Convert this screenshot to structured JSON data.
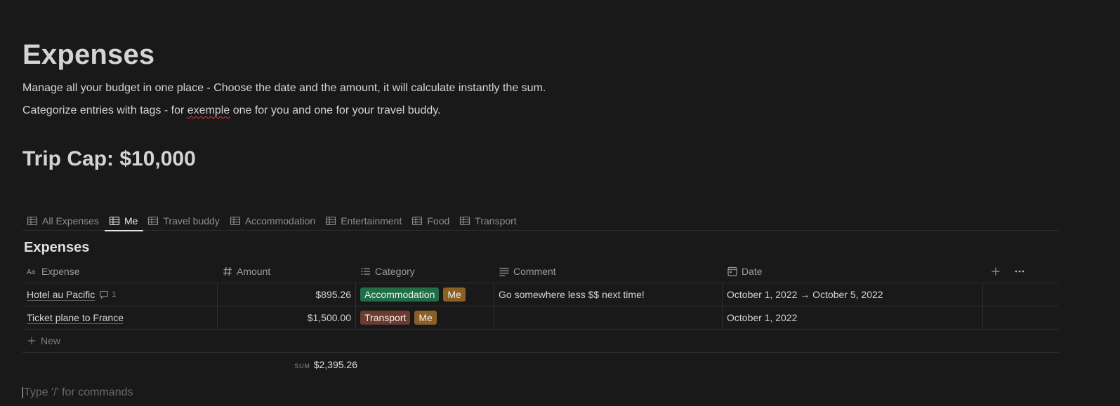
{
  "page": {
    "title": "Expenses",
    "description_1": "Manage all your budget in one place - Choose the date and the amount, it will calculate instantly the sum.",
    "description_2_before": "Categorize entries with tags - for ",
    "description_2_misspelled": "exemple",
    "description_2_after": " one for you and one for your travel buddy.",
    "heading": "Trip Cap: $10,000"
  },
  "tabs": [
    {
      "label": "All Expenses",
      "active": false
    },
    {
      "label": "Me",
      "active": true
    },
    {
      "label": "Travel buddy",
      "active": false
    },
    {
      "label": "Accommodation",
      "active": false
    },
    {
      "label": "Entertainment",
      "active": false
    },
    {
      "label": "Food",
      "active": false
    },
    {
      "label": "Transport",
      "active": false
    }
  ],
  "database": {
    "title": "Expenses",
    "columns": {
      "expense": "Expense",
      "amount": "Amount",
      "category": "Category",
      "comment": "Comment",
      "date": "Date"
    },
    "rows": [
      {
        "expense": "Hotel au Pacific",
        "comment_count": "1",
        "amount": "$895.26",
        "tags": [
          {
            "label": "Accommodation",
            "color": "#1f6e47"
          },
          {
            "label": "Me",
            "color": "#8c5f24"
          }
        ],
        "comment": "Go somewhere less $$ next time!",
        "date": "October 1, 2022 → October 5, 2022"
      },
      {
        "expense": "Ticket plane to France",
        "comment_count": "",
        "amount": "$1,500.00",
        "tags": [
          {
            "label": "Transport",
            "color": "#6a3b2e"
          },
          {
            "label": "Me",
            "color": "#8c5f24"
          }
        ],
        "comment": "",
        "date": "October 1, 2022"
      }
    ],
    "new_label": "New",
    "sum_label": "SUM",
    "sum_value": "$2,395.26"
  },
  "editor": {
    "placeholder": "Type '/' for commands"
  },
  "colors": {
    "background": "#191919",
    "text": "#d4d4d4",
    "muted": "#8f8f8f"
  }
}
